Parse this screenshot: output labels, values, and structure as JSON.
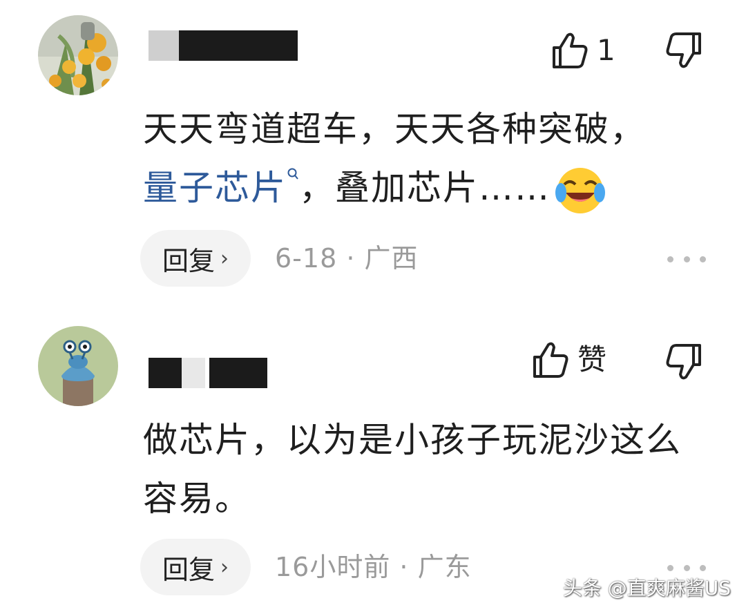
{
  "comments": [
    {
      "username": "",
      "like_label": "1",
      "content_parts": [
        "天天弯道超车，天天各种突破，",
        "量子芯片",
        "，叠加芯片……"
      ],
      "reply_label": "回复",
      "meta": "6-18 · 广西",
      "icons": {
        "avatar": "avatar-flowers",
        "like": "thumbs-up-icon",
        "dislike": "thumbs-down-icon",
        "topic": "search-icon",
        "emoji": "laughing-crying-emoji",
        "reply_arrow": "chevron-right-icon",
        "more": "more-icon"
      }
    },
    {
      "username": "",
      "like_label": "赞",
      "content": "做芯片，以为是小孩子玩泥沙这么容易。",
      "reply_label": "回复",
      "meta": "16小时前 · 广东",
      "icons": {
        "avatar": "avatar-cartoon",
        "like": "thumbs-up-icon",
        "dislike": "thumbs-down-icon",
        "reply_arrow": "chevron-right-icon",
        "more": "more-icon"
      }
    }
  ],
  "watermark": "头条 @直爽麻酱US",
  "colors": {
    "text": "#1f1f1f",
    "topic_link": "#2e5a9a",
    "meta": "#9a9a9a",
    "pill_bg": "#f3f3f3"
  }
}
